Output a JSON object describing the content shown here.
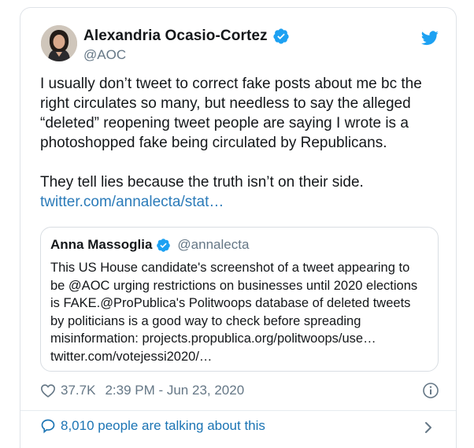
{
  "tweet": {
    "author": {
      "display_name": "Alexandria Ocasio-Cortez",
      "handle": "@AOC"
    },
    "body_lines": [
      "I usually don’t tweet to correct fake posts about me bc the",
      "right circulates so many, but needless to say the alleged",
      "“deleted” reopening tweet people are saying I wrote is a",
      "photoshopped fake being circulated by Republicans."
    ],
    "body_line_2": "They tell lies because the truth isn’t on their side.",
    "link": "twitter.com/annalecta/stat…",
    "likes": "37.7K",
    "timestamp": "2:39 PM - Jun 23, 2020",
    "conversation": "8,010 people are talking about this"
  },
  "quoted": {
    "display_name": "Anna Massoglia",
    "handle": "@annalecta",
    "lines": [
      "This US House candidate's screenshot of a tweet appearing to",
      "be @AOC urging restrictions on businesses until 2020 elections",
      "is FAKE.@ProPublica's Politwoops database of deleted tweets",
      "by politicians is a good way to check before spreading",
      "misinformation: projects.propublica.org/politwoops/use…",
      "twitter.com/votejessi2020/…"
    ]
  },
  "colors": {
    "twitter_blue": "#1da1f2",
    "link_blue": "#2b7bb9",
    "muted_gray": "#657786"
  },
  "icons": [
    "verified-badge-icon",
    "twitter-bird-icon",
    "heart-icon",
    "info-icon",
    "speech-bubble-icon",
    "chevron-right-icon"
  ]
}
